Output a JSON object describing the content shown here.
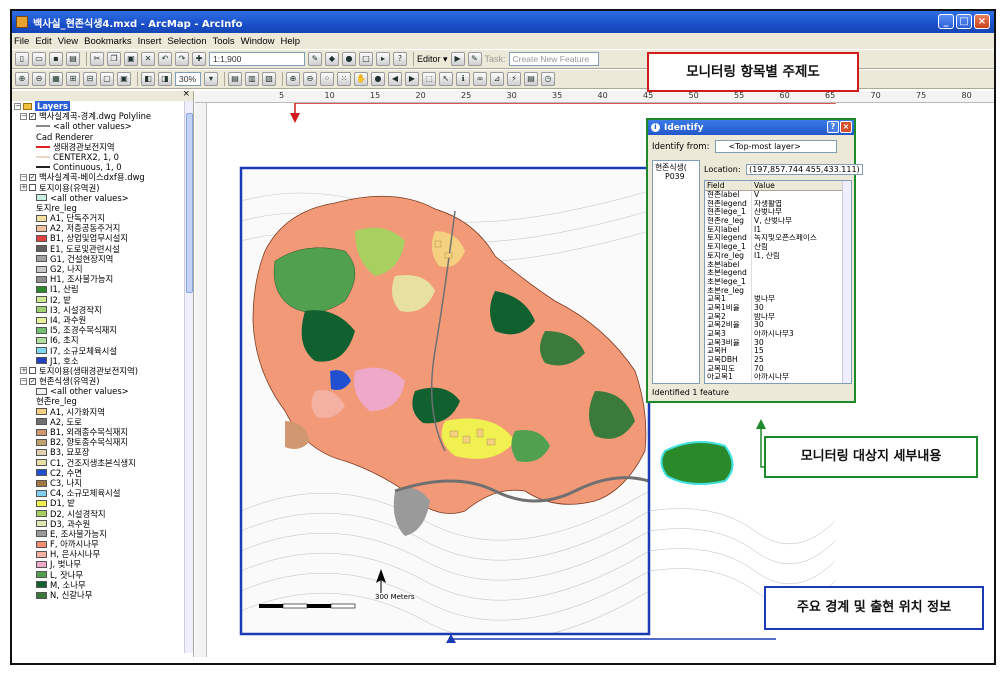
{
  "window": {
    "title": "백사실_현존식생4.mxd - ArcMap - ArcInfo",
    "buttons": [
      "_",
      "□",
      "×"
    ]
  },
  "menu": [
    "File",
    "Edit",
    "View",
    "Bookmarks",
    "Insert",
    "Selection",
    "Tools",
    "Window",
    "Help"
  ],
  "toolbar": {
    "scale": "1:1,900",
    "editor_label": "Editor ▾",
    "task_label": "Task:",
    "task_value": "Create New Feature",
    "zoom_percent": "30%"
  },
  "toc": {
    "root": "Layers",
    "items": [
      {
        "kind": "layer",
        "indent": 1,
        "checked": true,
        "text": "백사실계곡-경계.dwg Polyline"
      },
      {
        "kind": "line",
        "indent": 3,
        "color": "#888888",
        "text": "<all other values>"
      },
      {
        "kind": "text",
        "indent": 3,
        "text": "Cad Renderer"
      },
      {
        "kind": "line",
        "indent": 3,
        "color": "#e02020",
        "text": "생태경관보전지역"
      },
      {
        "kind": "line",
        "indent": 3,
        "color": "#e8d8c8",
        "text": "CENTERX2, 1, 0"
      },
      {
        "kind": "line",
        "indent": 3,
        "color": "#222222",
        "text": "Continuous, 1, 0"
      },
      {
        "kind": "layer",
        "indent": 1,
        "checked": true,
        "text": "백사실계곡-베이스dxf용.dwg"
      },
      {
        "kind": "layer",
        "indent": 1,
        "checked": false,
        "text": "토지이용(유역권)"
      },
      {
        "kind": "swatch",
        "indent": 3,
        "color": "#c8f0e0",
        "text": "<all other values>"
      },
      {
        "kind": "text",
        "indent": 3,
        "text": "토지re_leg"
      },
      {
        "kind": "swatch",
        "indent": 3,
        "color": "#f4e0a0",
        "text": "A1, 단독주거지"
      },
      {
        "kind": "swatch",
        "indent": 3,
        "color": "#f0c0a0",
        "text": "A2, 저층공동주거지"
      },
      {
        "kind": "swatch",
        "indent": 3,
        "color": "#e04040",
        "text": "B1, 상업및업무시설지"
      },
      {
        "kind": "swatch",
        "indent": 3,
        "color": "#606060",
        "text": "E1, 도로및관련시설"
      },
      {
        "kind": "swatch",
        "indent": 3,
        "color": "#a0a0a0",
        "text": "G1, 건설현장지역"
      },
      {
        "kind": "swatch",
        "indent": 3,
        "color": "#c8c8c8",
        "text": "G2, 나지"
      },
      {
        "kind": "swatch",
        "indent": 3,
        "color": "#909090",
        "text": "H1, 조사불가능지"
      },
      {
        "kind": "swatch",
        "indent": 3,
        "color": "#2a8a2a",
        "text": "I1, 산림"
      },
      {
        "kind": "swatch",
        "indent": 3,
        "color": "#d0e890",
        "text": "I2, 밭"
      },
      {
        "kind": "swatch",
        "indent": 3,
        "color": "#a0d070",
        "text": "I3, 시설경작지"
      },
      {
        "kind": "swatch",
        "indent": 3,
        "color": "#e8f0a0",
        "text": "I4, 과수원"
      },
      {
        "kind": "swatch",
        "indent": 3,
        "color": "#70c070",
        "text": "I5, 조경수목식재지"
      },
      {
        "kind": "swatch",
        "indent": 3,
        "color": "#b0e0a0",
        "text": "I6, 초지"
      },
      {
        "kind": "swatch",
        "indent": 3,
        "color": "#80d8f0",
        "text": "I7, 소규모체육시설"
      },
      {
        "kind": "swatch",
        "indent": 3,
        "color": "#2040c0",
        "text": "J1, 호소"
      },
      {
        "kind": "layer",
        "indent": 1,
        "checked": false,
        "text": "토지이용(생태경관보전지역)"
      },
      {
        "kind": "layer",
        "indent": 1,
        "checked": true,
        "text": "현존식생(유역권)"
      },
      {
        "kind": "swatch",
        "indent": 3,
        "color": "#f0f0f0",
        "text": "<all other values>"
      },
      {
        "kind": "text",
        "indent": 3,
        "text": "현존re_leg"
      },
      {
        "kind": "swatch",
        "indent": 3,
        "color": "#f4d080",
        "text": "A1, 시가화지역"
      },
      {
        "kind": "swatch",
        "indent": 3,
        "color": "#707070",
        "text": "A2, 도로"
      },
      {
        "kind": "swatch",
        "indent": 3,
        "color": "#d09870",
        "text": "B1, 외래종수목식재지"
      },
      {
        "kind": "swatch",
        "indent": 3,
        "color": "#c0a070",
        "text": "B2, 향토종수목식재지"
      },
      {
        "kind": "swatch",
        "indent": 3,
        "color": "#e0d0b0",
        "text": "B3, 묘포장"
      },
      {
        "kind": "swatch",
        "indent": 3,
        "color": "#e8e0a0",
        "text": "C1, 건조지생초본식생지"
      },
      {
        "kind": "swatch",
        "indent": 3,
        "color": "#2050d0",
        "text": "C2, 수면"
      },
      {
        "kind": "swatch",
        "indent": 3,
        "color": "#a07840",
        "text": "C3, 나지"
      },
      {
        "kind": "swatch",
        "indent": 3,
        "color": "#80d0f0",
        "text": "C4, 소규모체육시설"
      },
      {
        "kind": "swatch",
        "indent": 3,
        "color": "#f0f050",
        "text": "D1, 밭"
      },
      {
        "kind": "swatch",
        "indent": 3,
        "color": "#a8d060",
        "text": "D2, 시설경작지"
      },
      {
        "kind": "swatch",
        "indent": 3,
        "color": "#e0e8b0",
        "text": "D3, 과수원"
      },
      {
        "kind": "swatch",
        "indent": 3,
        "color": "#9a9a9a",
        "text": "E, 조사불가능지"
      },
      {
        "kind": "swatch",
        "indent": 3,
        "color": "#f09070",
        "text": "F, 아까시나무"
      },
      {
        "kind": "swatch",
        "indent": 3,
        "color": "#f4b0a0",
        "text": "H, 은사시나무"
      },
      {
        "kind": "swatch",
        "indent": 3,
        "color": "#f0a8c8",
        "text": "J, 벚나무"
      },
      {
        "kind": "swatch",
        "indent": 3,
        "color": "#50a050",
        "text": "L, 잣나무"
      },
      {
        "kind": "swatch",
        "indent": 3,
        "color": "#106030",
        "text": "M, 소나무"
      },
      {
        "kind": "swatch",
        "indent": 3,
        "color": "#3a7a3a",
        "text": "N, 신갈나무"
      }
    ]
  },
  "ruler_ticks": [
    "5",
    "10",
    "15",
    "20",
    "25",
    "30",
    "35",
    "40",
    "45",
    "50",
    "55",
    "60",
    "65",
    "70",
    "75",
    "80"
  ],
  "map": {
    "scale_text": "300 Meters"
  },
  "identify": {
    "title": "Identify",
    "from_label": "Identify from:",
    "from_value": "<Top-most layer>",
    "tree_layer": "현존식생(",
    "tree_id": "P039",
    "location_label": "Location:",
    "location_value": "(197,857.744  455,433.111)",
    "columns": [
      "Field",
      "Value"
    ],
    "rows": [
      [
        "현존label",
        "V"
      ],
      [
        "현존legend",
        "자생활엽"
      ],
      [
        "현존lege_1",
        "산벚나무"
      ],
      [
        "현존re_leg",
        "V, 산벚나무"
      ],
      [
        "토지label",
        "I1"
      ],
      [
        "토지legend",
        "녹지및오픈스페이스"
      ],
      [
        "토지lege_1",
        "산림"
      ],
      [
        "토지re_leg",
        "I1, 산림"
      ],
      [
        "초본label",
        ""
      ],
      [
        "초본legend",
        ""
      ],
      [
        "초본lege_1",
        ""
      ],
      [
        "초본re_leg",
        ""
      ],
      [
        "교목1",
        "벚나무"
      ],
      [
        "교목1비율",
        "30"
      ],
      [
        "교목2",
        "밤나무"
      ],
      [
        "교목2비율",
        "30"
      ],
      [
        "교목3",
        "아까시나무3"
      ],
      [
        "교목3비율",
        "30"
      ],
      [
        "교목H",
        "15"
      ],
      [
        "교목DBH",
        "25"
      ],
      [
        "교목피도",
        "70"
      ],
      [
        "아교목1",
        "아까시나무"
      ]
    ],
    "status": "Identified 1 feature"
  },
  "callouts": {
    "theme": "모니터링 항목별 주제도",
    "detail": "모니터링 대상지 세부내용",
    "boundary": "주요 경계 및 출현 위치 정보"
  },
  "colors": {
    "callout_theme": "#d01c1c",
    "callout_detail": "#1e8a2c",
    "callout_boundary": "#1a3bb5"
  }
}
